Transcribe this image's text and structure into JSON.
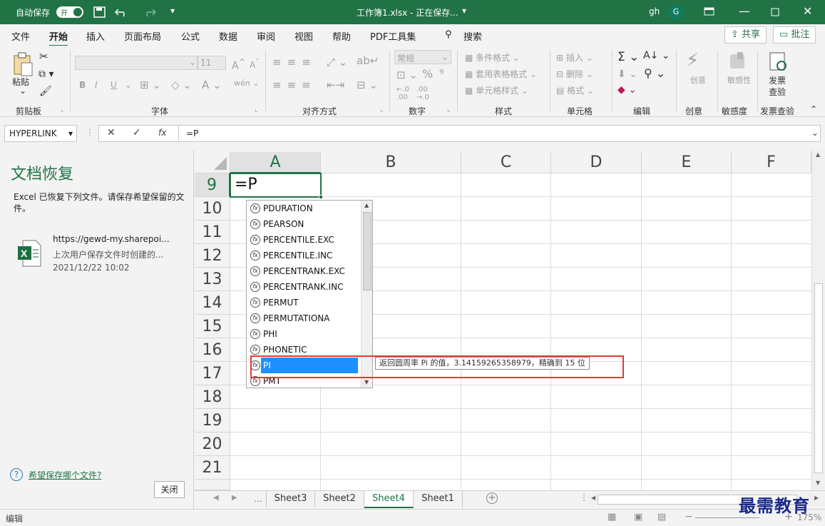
{
  "titlebar": {
    "autosave_label": "自动保存",
    "autosave_state": "开",
    "doc_title": "工作簿1.xlsx - 正在保存...",
    "user": "gh",
    "avatar_letter": "G"
  },
  "tabs": [
    "文件",
    "开始",
    "插入",
    "页面布局",
    "公式",
    "数据",
    "审阅",
    "视图",
    "帮助",
    "PDF工具集",
    "搜索"
  ],
  "share_label": "共享",
  "comment_label": "批注",
  "ribbon": {
    "paste": "粘贴",
    "groups": [
      "剪贴板",
      "字体",
      "对齐方式",
      "数字",
      "样式",
      "单元格",
      "编辑",
      "创意",
      "敏感度",
      "发票查验"
    ],
    "font_size": "11",
    "number_format": "常规",
    "style_items": [
      "条件格式",
      "套用表格格式",
      "单元格样式"
    ],
    "cell_items": [
      "插入",
      "删除",
      "格式"
    ],
    "creative": "创意",
    "sensitivity": "敏感性",
    "invoice": [
      "发票",
      "查验"
    ],
    "font_buttons": [
      "B",
      "I",
      "U"
    ]
  },
  "formula_bar": {
    "name_box": "HYPERLINK",
    "fx": "fx",
    "formula": "=P"
  },
  "recovery": {
    "title": "文档恢复",
    "desc": "Excel 已恢复下列文件。请保存希望保留的文件。",
    "file_url": "https://gewd-my.sharepoi...",
    "file_note": "上次用户保存文件时创建的...",
    "file_date": "2021/12/22 10:02",
    "help_link": "希望保存哪个文件?",
    "close_button": "关闭"
  },
  "grid": {
    "columns": [
      "A",
      "B",
      "C",
      "D",
      "E",
      "F"
    ],
    "rows": [
      "9",
      "10",
      "11",
      "12",
      "13",
      "14",
      "15",
      "16",
      "17",
      "18",
      "19",
      "20",
      "21"
    ],
    "active_cell_value": "=P"
  },
  "autocomplete": {
    "items": [
      "PDURATION",
      "PEARSON",
      "PERCENTILE.EXC",
      "PERCENTILE.INC",
      "PERCENTRANK.EXC",
      "PERCENTRANK.INC",
      "PERMUT",
      "PERMUTATIONA",
      "PHI",
      "PHONETIC",
      "PI",
      "PMT"
    ],
    "selected": "PI",
    "tooltip": "返回圆周率 Pi 的值，3.14159265358979，精确到 15 位"
  },
  "sheets": [
    "Sheet3",
    "Sheet2",
    "Sheet4",
    "Sheet1"
  ],
  "active_sheet": "Sheet4",
  "status": {
    "mode": "编辑",
    "zoom": "175%"
  },
  "watermark": "最需教育",
  "colors": {
    "excel_green": "#217346",
    "selection_blue": "#1e90ff",
    "highlight_red": "#e53935"
  }
}
